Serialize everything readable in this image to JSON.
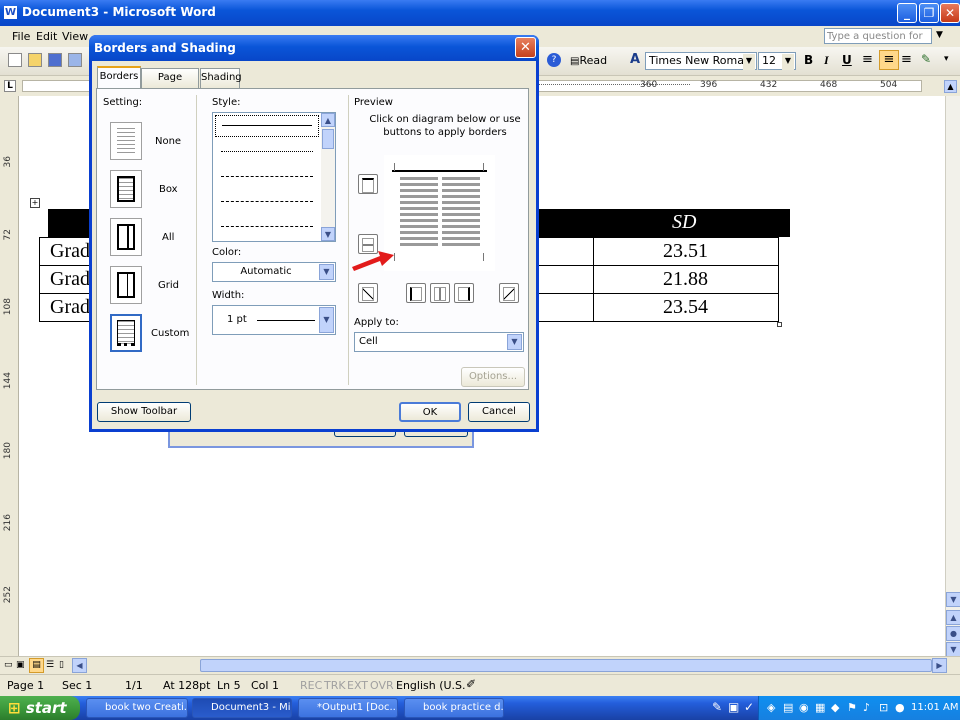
{
  "window": {
    "title": "Document3 - Microsoft Word"
  },
  "menu": {
    "items": [
      "File",
      "Edit",
      "View"
    ],
    "help_placeholder": "Type a question for help"
  },
  "toolbar": {
    "read_label": "Read",
    "font_name": "Times New Roman",
    "font_size": "12"
  },
  "ruler": {
    "marks": [
      "360",
      "396",
      "432",
      "468",
      "504"
    ],
    "vertical_marks": [
      "36",
      "72",
      "108",
      "144",
      "180",
      "216",
      "252"
    ]
  },
  "table": {
    "header": "SD",
    "rows": [
      {
        "label": "Grad",
        "value": "23.51"
      },
      {
        "label": "Grad",
        "value": "21.88"
      },
      {
        "label": "Grad",
        "value": "23.54"
      }
    ]
  },
  "dialog": {
    "title": "Borders and Shading",
    "tabs": [
      "Borders",
      "Page Border",
      "Shading"
    ],
    "setting_label": "Setting:",
    "settings": [
      "None",
      "Box",
      "All",
      "Grid",
      "Custom"
    ],
    "style_label": "Style:",
    "color_label": "Color:",
    "color_value": "Automatic",
    "width_label": "Width:",
    "width_value": "1 pt",
    "preview_label": "Preview",
    "preview_hint": "Click on diagram below or use buttons to apply borders",
    "apply_label": "Apply to:",
    "apply_value": "Cell",
    "options_label": "Options...",
    "show_toolbar_label": "Show Toolbar",
    "ok_label": "OK",
    "cancel_label": "Cancel"
  },
  "status": {
    "page": "Page 1",
    "sec": "Sec 1",
    "pages": "1/1",
    "at": "At 128pt",
    "ln": "Ln 5",
    "col": "Col 1",
    "modes": [
      "REC",
      "TRK",
      "EXT",
      "OVR"
    ],
    "language": "English (U.S."
  },
  "taskbar": {
    "start_label": "start",
    "tasks": [
      "book two Creati...",
      "Document3 - Mi...",
      "*Output1 [Doc...",
      "book practice d..."
    ],
    "clock": "11:01 AM"
  }
}
